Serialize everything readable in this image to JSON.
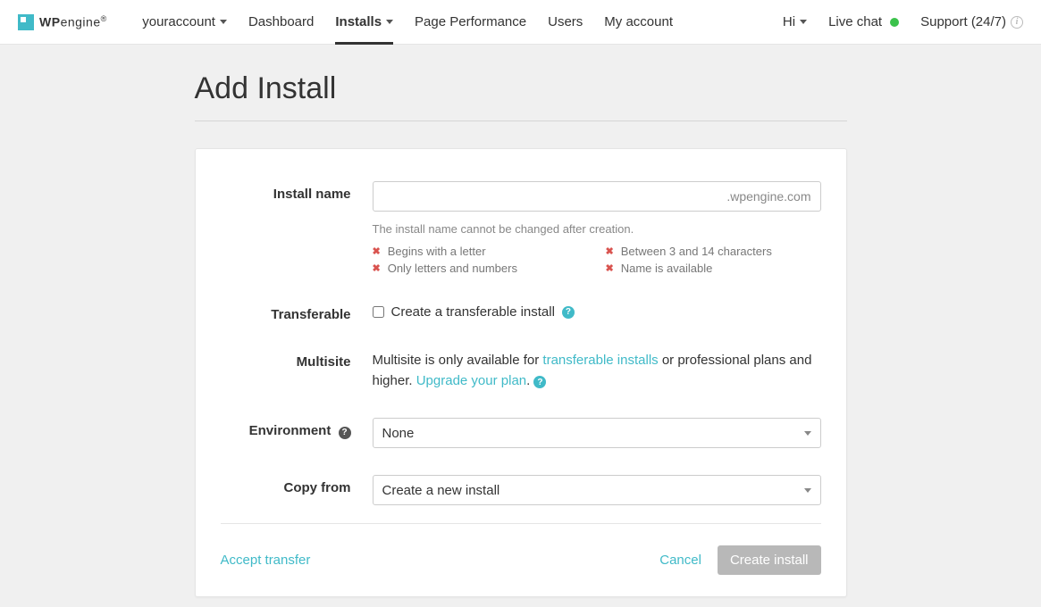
{
  "logo": {
    "wp": "WP",
    "engine": "engine",
    "reg": "®"
  },
  "nav": {
    "account": "youraccount",
    "items": [
      "Dashboard",
      "Installs",
      "Page Performance",
      "Users",
      "My account"
    ],
    "hi": "Hi",
    "live_chat": "Live chat",
    "support": "Support (24/7)"
  },
  "page_title": "Add Install",
  "form": {
    "install_name": {
      "label": "Install name",
      "suffix": ".wpengine.com",
      "hint": "The install name cannot be changed after creation.",
      "validations": [
        "Begins with a letter",
        "Between 3 and 14 characters",
        "Only letters and numbers",
        "Name is available"
      ]
    },
    "transferable": {
      "label": "Transferable",
      "checkbox_label": "Create a transferable install"
    },
    "multisite": {
      "label": "Multisite",
      "text_1": "Multisite is only available for ",
      "link_1": "transferable installs",
      "text_2": " or professional plans and higher. ",
      "link_2": "Upgrade your plan",
      "text_3": "."
    },
    "environment": {
      "label": "Environment",
      "value": "None"
    },
    "copy_from": {
      "label": "Copy from",
      "value": "Create a new install"
    }
  },
  "footer": {
    "accept_transfer": "Accept transfer",
    "cancel": "Cancel",
    "create": "Create install"
  }
}
